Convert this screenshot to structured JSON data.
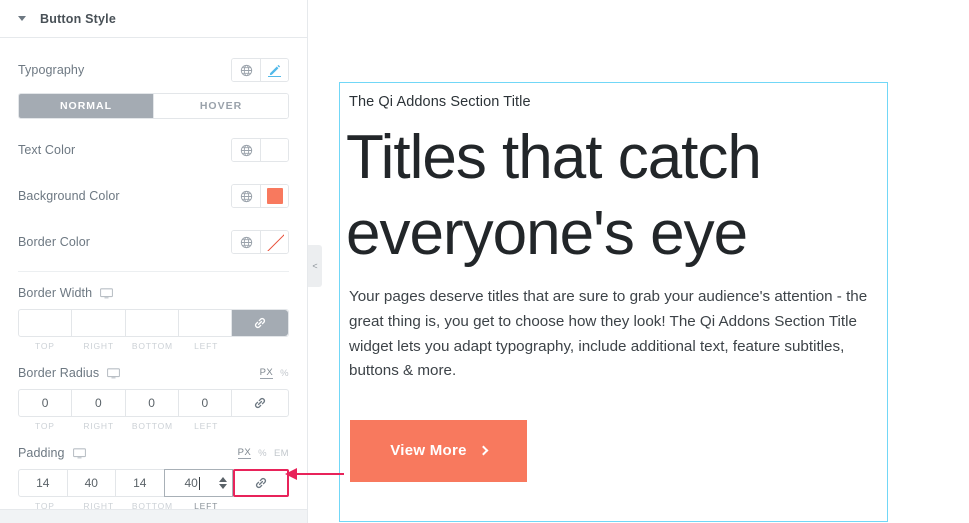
{
  "panel": {
    "title": "Button Style",
    "caret_icon": "caret-down-icon",
    "rows": {
      "typography": {
        "label": "Typography",
        "globe_icon": "globe-icon",
        "edit_icon": "pencil-icon"
      },
      "text_color": {
        "label": "Text Color",
        "globe_icon": "globe-icon",
        "swatch": ""
      },
      "background_color": {
        "label": "Background Color",
        "globe_icon": "globe-icon",
        "swatch": "#F8795E"
      },
      "border_color": {
        "label": "Border Color",
        "globe_icon": "globe-icon",
        "swatch": "none"
      }
    },
    "state_tabs": [
      {
        "label": "NORMAL",
        "active": true
      },
      {
        "label": "HOVER",
        "active": false
      }
    ],
    "border_width": {
      "label": "Border Width",
      "device_icon": "desktop-monitor-icon",
      "values": [
        "",
        "",
        "",
        ""
      ],
      "side_labels": [
        "TOP",
        "RIGHT",
        "BOTTOM",
        "LEFT"
      ],
      "link_icon": "link-chain-icon",
      "link_active": true
    },
    "border_radius": {
      "label": "Border Radius",
      "device_icon": "desktop-monitor-icon",
      "units": [
        "PX",
        "%"
      ],
      "active_unit": "PX",
      "values": [
        "0",
        "0",
        "0",
        "0"
      ],
      "side_labels": [
        "TOP",
        "RIGHT",
        "BOTTOM",
        "LEFT"
      ],
      "link_icon": "link-chain-icon",
      "link_active": false
    },
    "padding": {
      "label": "Padding",
      "device_icon": "desktop-monitor-icon",
      "units": [
        "PX",
        "%",
        "EM"
      ],
      "active_unit": "PX",
      "values": [
        "14",
        "40",
        "14",
        "40"
      ],
      "focused_index": 3,
      "side_labels": [
        "TOP",
        "RIGHT",
        "BOTTOM",
        "LEFT"
      ],
      "link_icon": "link-chain-icon",
      "link_highlighted": true,
      "highlight_color": "#E8235A"
    },
    "collapse_handle": {
      "icon": "chevron-left-icon",
      "label": "<"
    }
  },
  "preview": {
    "eyebrow": "The Qi Addons Section Title",
    "title_line1": "Titles that catch",
    "title_line2": "everyone's eye",
    "paragraph": "Your pages deserve titles that are sure to grab your audience's attention - the great thing is, you get to choose how they look! The Qi Addons Section Title widget lets you adapt typography, include additional text, feature subtitles, buttons & more.",
    "button": {
      "label": "View More",
      "icon": "chevron-right-icon",
      "bg": "#F8795E",
      "color": "#FFFFFF"
    },
    "outline_color": "#71D7F7"
  },
  "annotation": {
    "arrow_icon": "arrow-left-icon",
    "color": "#E8235A"
  }
}
